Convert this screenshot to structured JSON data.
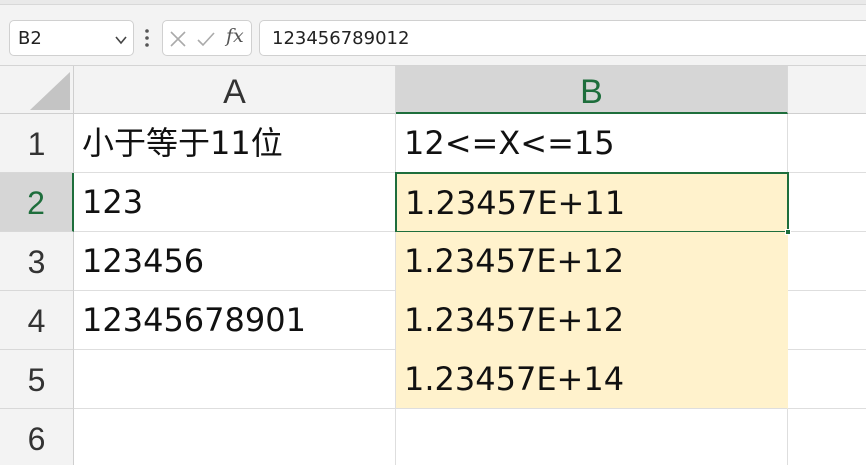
{
  "formula_bar": {
    "name_box": "B2",
    "formula": "123456789012",
    "fx_label": "fx"
  },
  "columns": [
    {
      "label": "A"
    },
    {
      "label": "B"
    }
  ],
  "rows": [
    {
      "label": "1",
      "a": "小于等于11位",
      "b": "12<=X<=15"
    },
    {
      "label": "2",
      "a": "123",
      "b": "1.23457E+11"
    },
    {
      "label": "3",
      "a": "123456",
      "b": "1.23457E+12"
    },
    {
      "label": "4",
      "a": "12345678901",
      "b": "1.23457E+12"
    },
    {
      "label": "5",
      "a": "",
      "b": "1.23457E+14"
    },
    {
      "label": "6",
      "a": "",
      "b": ""
    }
  ],
  "selection": {
    "cell": "B2"
  },
  "colors": {
    "accent": "#1e6e3c",
    "highlight_fill": "#fff2cc",
    "header_bg": "#f3f3f3"
  }
}
